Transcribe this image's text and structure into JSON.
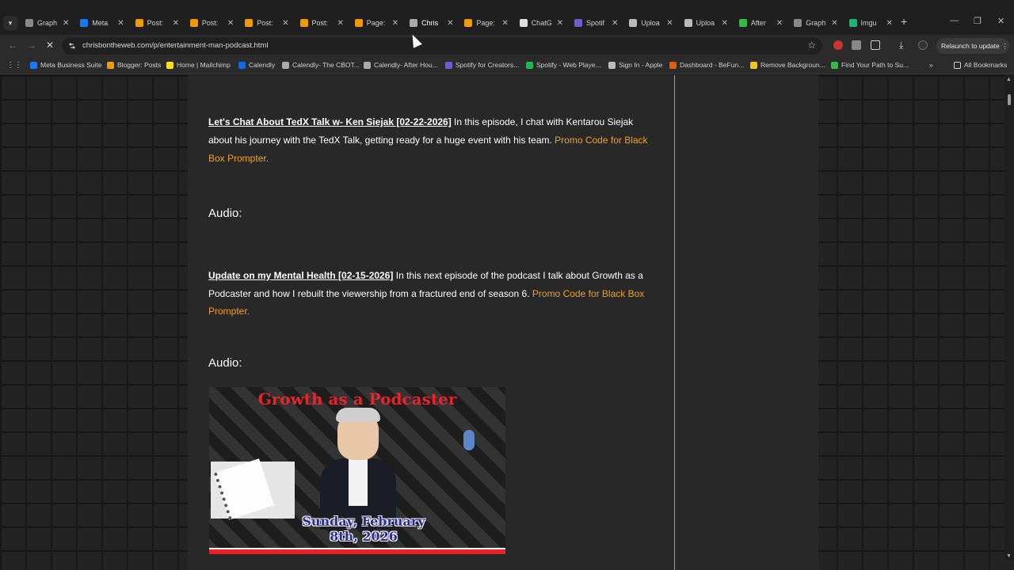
{
  "tabs": [
    {
      "label": "Graph",
      "color": "#888888"
    },
    {
      "label": "Meta",
      "color": "#1877f2"
    },
    {
      "label": "Post:",
      "color": "#f29900"
    },
    {
      "label": "Post:",
      "color": "#f29900"
    },
    {
      "label": "Post:",
      "color": "#f29900"
    },
    {
      "label": "Post:",
      "color": "#f29900"
    },
    {
      "label": "Page:",
      "color": "#f29900"
    },
    {
      "label": "Chris",
      "color": "#aaaaaa"
    },
    {
      "label": "Page:",
      "color": "#f29900"
    },
    {
      "label": "ChatG",
      "color": "#dddddd"
    },
    {
      "label": "Spotif",
      "color": "#6e5ccf"
    },
    {
      "label": "Uploa",
      "color": "#bbbbbb"
    },
    {
      "label": "Uploa",
      "color": "#bbbbbb"
    },
    {
      "label": "After",
      "color": "#2fbf3f"
    },
    {
      "label": "Graph",
      "color": "#888888"
    },
    {
      "label": "Imgu",
      "color": "#1bb76e"
    }
  ],
  "active_tab_index": 7,
  "address": {
    "url": "chrisbontheweb.com/p/entertainment-man-podcast.html"
  },
  "relaunch_label": "Relaunch to update",
  "bookmarks": [
    {
      "label": "Meta Business Suite",
      "color": "#1877f2"
    },
    {
      "label": "Blogger: Posts",
      "color": "#f29900"
    },
    {
      "label": "Home | Mailchimp",
      "color": "#ffe01b"
    },
    {
      "label": "Calendly",
      "color": "#006bff"
    },
    {
      "label": "Calendly- The CBOT...",
      "color": "#aaaaaa"
    },
    {
      "label": "Calendly- After Hou...",
      "color": "#aaaaaa"
    },
    {
      "label": "Spotify for Creators...",
      "color": "#6e5ccf"
    },
    {
      "label": "Spotify - Web Playe...",
      "color": "#1db954"
    },
    {
      "label": "Sign In - Apple",
      "color": "#bbbbbb"
    },
    {
      "label": "Dashboard - BeFun...",
      "color": "#e05d00"
    },
    {
      "label": "Remove Backgroun...",
      "color": "#f5c518"
    },
    {
      "label": "Find Your Path to Su...",
      "color": "#2fbf3f"
    }
  ],
  "all_bookmarks_label": "All Bookmarks",
  "episodes": [
    {
      "title": "Let's Chat About TedX Talk w- Ken Siejak [02-22-2026]",
      "description": " In this episode, I chat with Kentarou Siejak about his journey with the TedX Talk, getting ready for a huge event with his team. ",
      "promo": "Promo Code for Black Box Prompter.",
      "audio_label": "Audio:"
    },
    {
      "title": "Update on my Mental Health [02-15-2026]",
      "description": " In this next episode of the podcast I talk about Growth as a Podcaster and how I rebuilt the viewership from a fractured end of season 6. ",
      "promo": "Promo Code for Black Box Prompter.",
      "audio_label": "Audio:"
    }
  ],
  "thumbnail": {
    "title": "Growth as a Podcaster",
    "date_line1": "Sunday, February",
    "date_line2": "8th, 2026"
  }
}
